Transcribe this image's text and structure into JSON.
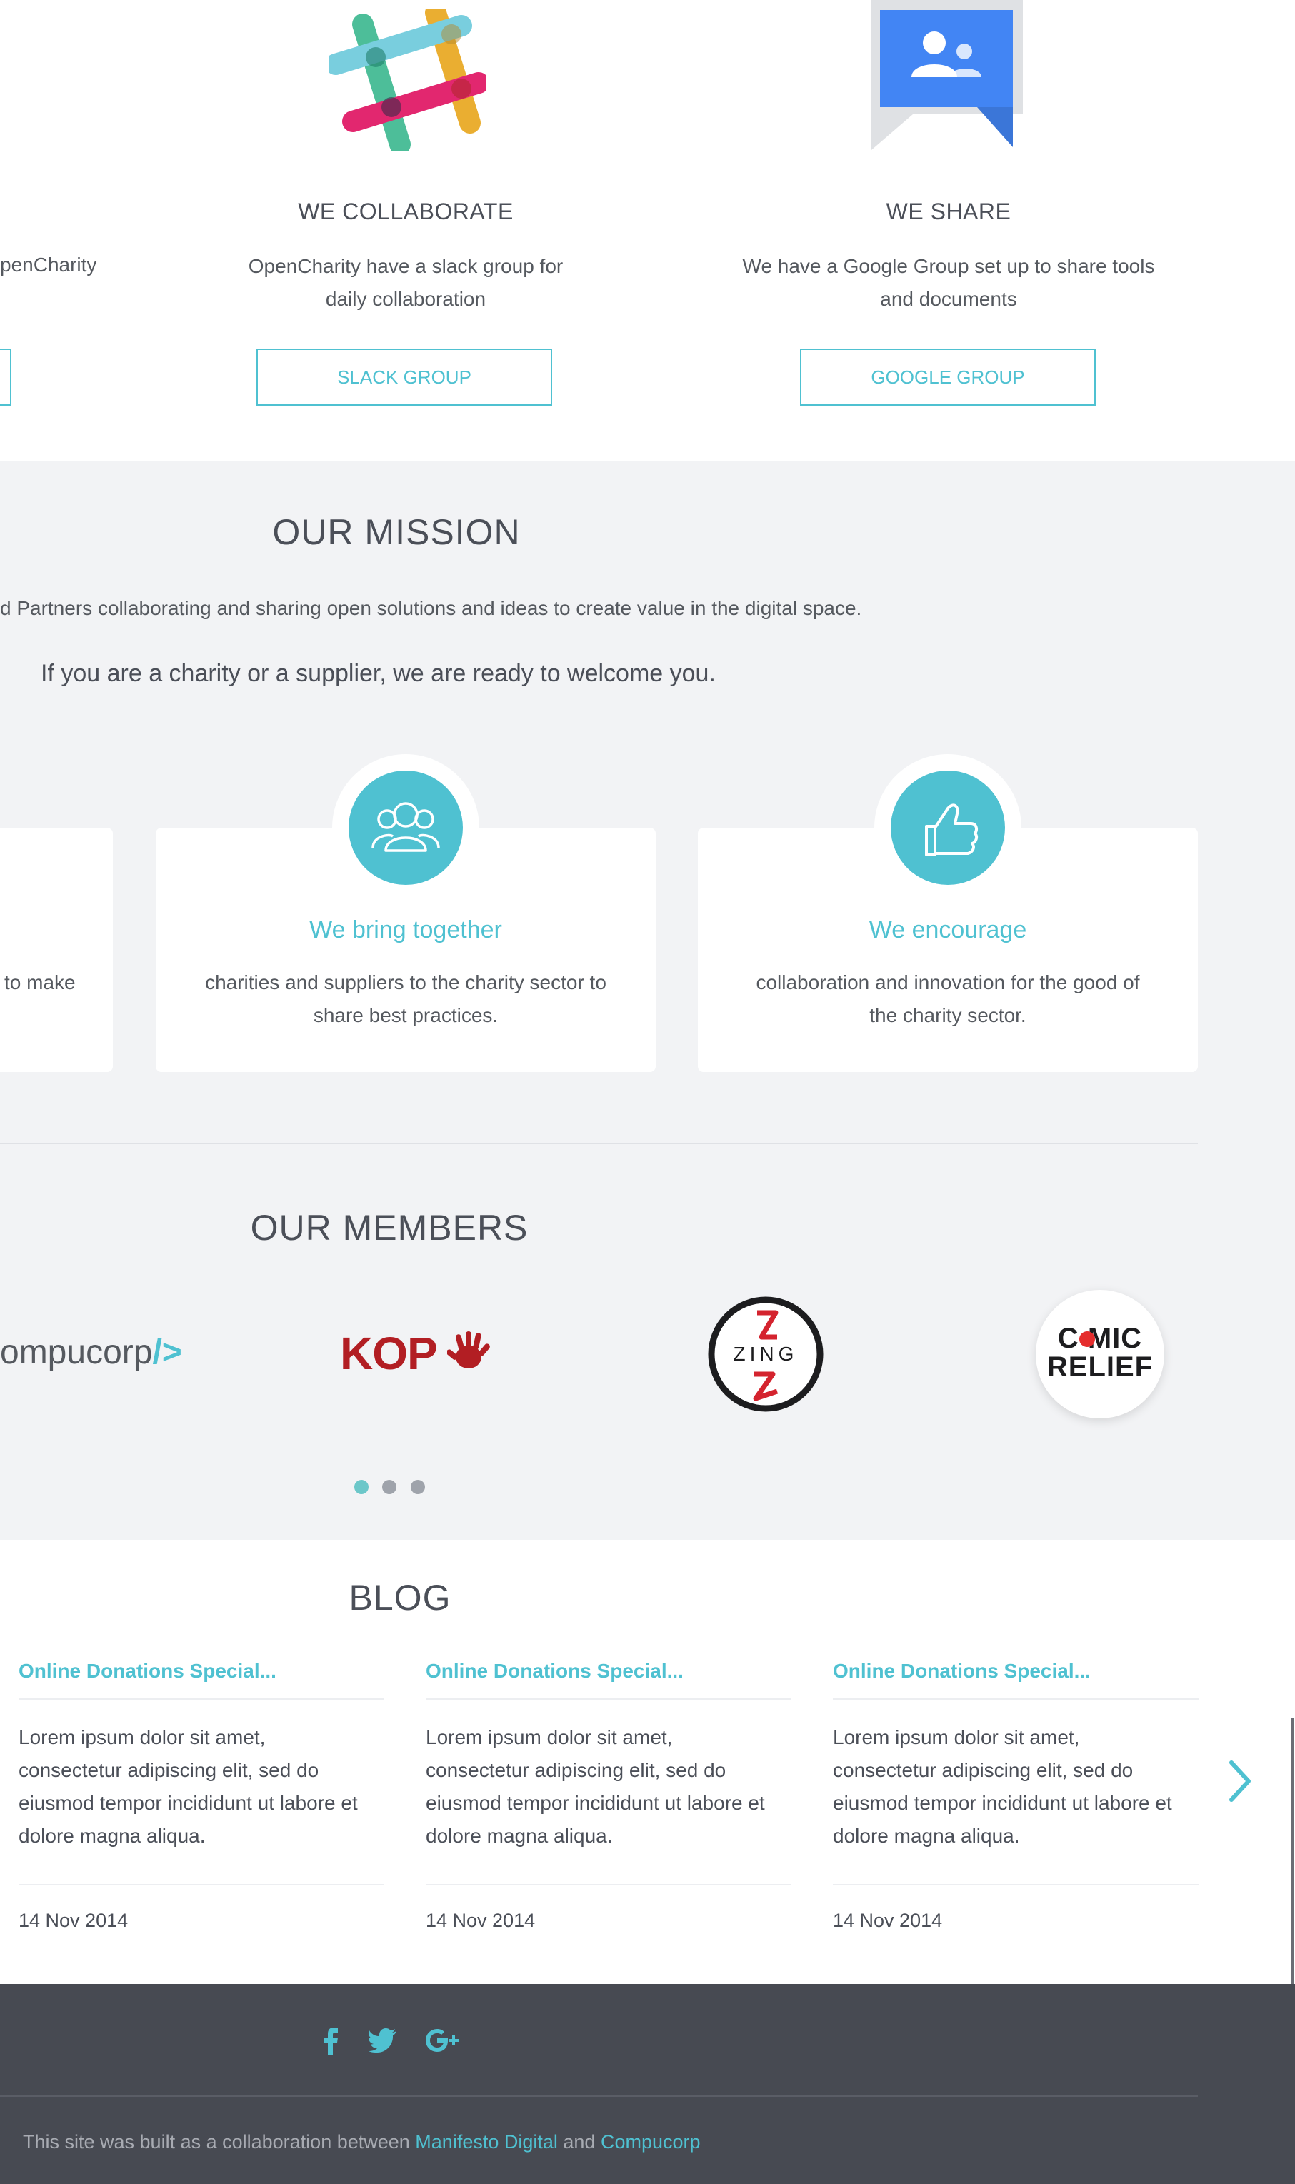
{
  "collab": {
    "left_fragment_text": "penCharity",
    "columns": [
      {
        "title": "WE COLLABORATE",
        "text_line1": "OpenCharity have a slack group for",
        "text_line2": "daily collaboration",
        "button": "SLACK GROUP",
        "icon": "slack-icon"
      },
      {
        "title": "WE SHARE",
        "text_line1": "We have a Google Group set up to share tools",
        "text_line2": "and documents",
        "button": "GOOGLE GROUP",
        "icon": "google-group-icon"
      }
    ]
  },
  "mission": {
    "title": "OUR MISSION",
    "text": "d Partners collaborating and sharing open solutions and ideas to create value in the digital space.",
    "welcome": "If you are a charity or a supplier, we are ready to welcome you.",
    "left_card_fragment": "to make",
    "cards": [
      {
        "title": "We bring together",
        "text_line1": "charities and suppliers to the charity sector to",
        "text_line2": "share best practices.",
        "icon": "people-icon"
      },
      {
        "title": "We encourage",
        "text_line1": "collaboration and innovation for the good of",
        "text_line2": "the charity sector.",
        "icon": "thumbs-up-icon"
      }
    ]
  },
  "members": {
    "title": "OUR MEMBERS",
    "logos": {
      "compucorp": "ompucorp",
      "compucorp_suffix": "/>",
      "kop": "KOP",
      "zing": "ZING",
      "comic_line1": "C MIC",
      "comic_line2": "RELIEF"
    },
    "dots": 3,
    "active_dot": 0
  },
  "blog": {
    "title": "BLOG",
    "posts": [
      {
        "title": "Online Donations Special...",
        "body": [
          "Lorem ipsum dolor sit amet,",
          "consectetur adipiscing elit, sed do",
          "eiusmod tempor incididunt ut labore et",
          "dolore magna aliqua."
        ],
        "date": "14 Nov 2014"
      },
      {
        "title": "Online Donations Special...",
        "body": [
          "Lorem ipsum dolor sit amet,",
          "consectetur adipiscing elit, sed do",
          "eiusmod tempor incididunt ut labore et",
          "dolore magna aliqua."
        ],
        "date": "14 Nov 2014"
      },
      {
        "title": "Online Donations Special...",
        "body": [
          "Lorem ipsum dolor sit amet,",
          "consectetur adipiscing elit, sed do",
          "eiusmod tempor incididunt ut labore et",
          "dolore magna aliqua."
        ],
        "date": "14 Nov 2014"
      }
    ],
    "next_icon": "chevron-right-icon"
  },
  "footer": {
    "social": [
      "facebook-icon",
      "twitter-icon",
      "google-plus-icon"
    ],
    "text_before": "This site was built as a collaboration between ",
    "link1": "Manifesto Digital",
    "text_middle": " and ",
    "link2": "Compucorp"
  },
  "colors": {
    "accent": "#4fc1d1",
    "gray_bg": "#f2f3f5",
    "footer_bg": "#474a52",
    "text": "#4b4f58"
  }
}
